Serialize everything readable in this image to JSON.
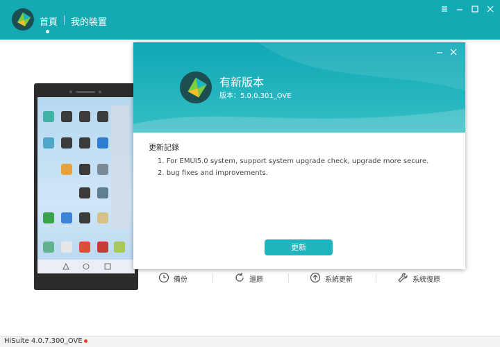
{
  "header": {
    "home_tab": "首頁",
    "devices_tab": "我的裝置",
    "accent": "#14aab4"
  },
  "dialog": {
    "title": "有新版本",
    "version": "版本：5.0.0.301_OVE",
    "changelog_title": "更新記錄",
    "changelog": [
      "1. For EMUI5.0 system, support system upgrade check, upgrade more secure.",
      "2. bug fixes and improvements."
    ],
    "update_button": "更新"
  },
  "actions": {
    "backup": "備份",
    "restore": "還原",
    "system_update": "系統更新",
    "system_recovery": "系統復原"
  },
  "status": {
    "version": "HiSuite 4.0.7.300_OVE"
  },
  "icons": [
    "app-logo-icon",
    "minimize-icon",
    "restore-icon",
    "close-icon",
    "backup-icon",
    "restore-arrow-icon",
    "system-update-icon",
    "wrench-icon"
  ]
}
